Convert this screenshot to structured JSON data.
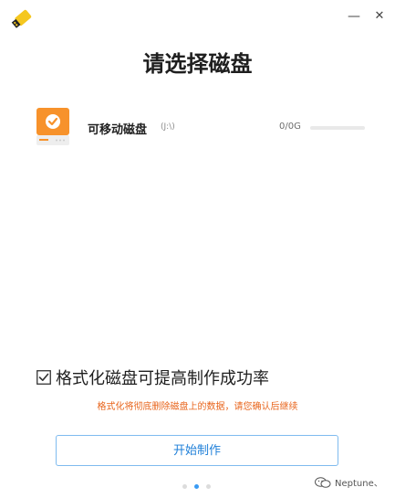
{
  "window": {
    "minimize_glyph": "—",
    "close_glyph": "✕"
  },
  "page": {
    "title": "请选择磁盘"
  },
  "disks": [
    {
      "name": "可移动磁盘",
      "drive": "(J:\\)",
      "size": "0/0G",
      "usage_fraction": 0,
      "selected": true
    }
  ],
  "format_option": {
    "checked": true,
    "label": "格式化磁盘可提高制作成功率",
    "warning": "格式化将彻底删除磁盘上的数据，请您确认后继续"
  },
  "actions": {
    "start_label": "开始制作"
  },
  "pagination": {
    "total": 3,
    "active_index": 1
  },
  "watermark": {
    "text": "Neptune、"
  },
  "colors": {
    "accent": "#3a9bf4",
    "disk_icon": "#f7922b",
    "warning": "#e8641b",
    "logo": "#f5c71f"
  },
  "icons": {
    "app_logo": "usb-drive-icon",
    "disk": "disk-check-icon",
    "checkbox": "checkbox-checked-icon",
    "watermark": "wechat-icon"
  }
}
